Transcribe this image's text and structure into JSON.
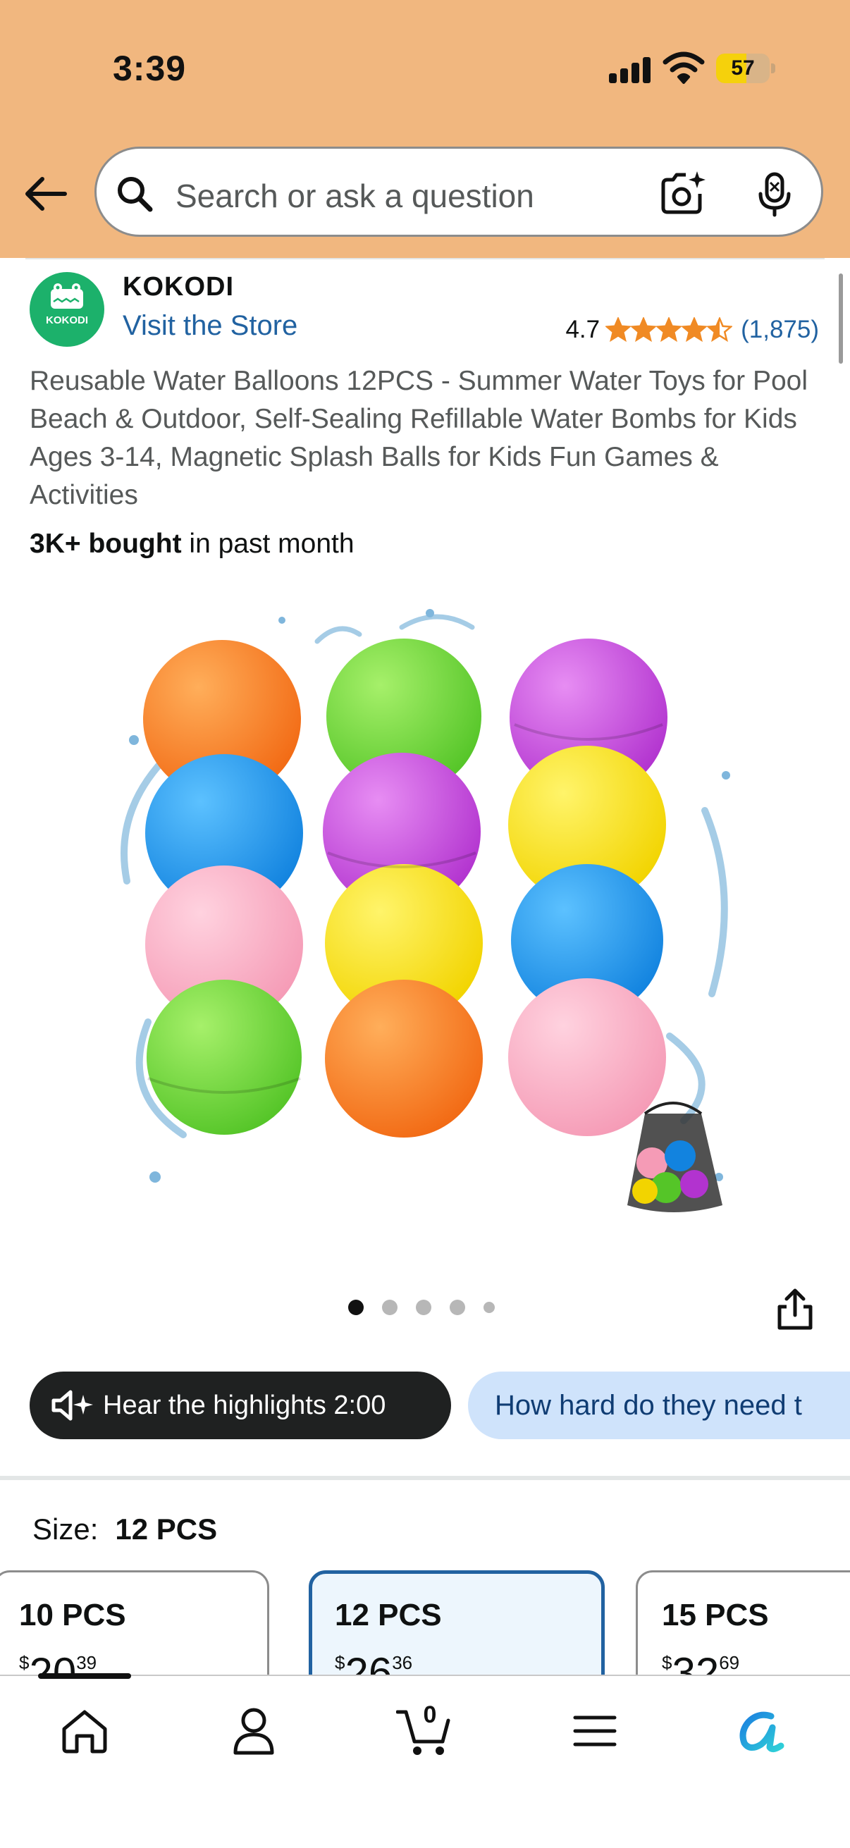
{
  "status_bar": {
    "time": "3:39",
    "battery": "57",
    "battery_level": 0.57
  },
  "search": {
    "placeholder": "Search or ask a question"
  },
  "brand": {
    "name": "KOKODI",
    "logo_text": "KOKODI",
    "visit_store": "Visit the Store"
  },
  "rating": {
    "value": "4.7",
    "stars": 4.5,
    "count": "(1,875)"
  },
  "product": {
    "title": "Reusable Water Balloons 12PCS - Summer Water Toys for Pool Beach & Outdoor, Self-Sealing Refillable Water Bombs for Kids Ages 3-14, Magnetic Splash Balls for Kids Fun Games & Activities",
    "bought_bold": "3K+ bought",
    "bought_rest": " in past month"
  },
  "carousel": {
    "dot_count": 5,
    "active_index": 0
  },
  "chips": {
    "hear_highlights": "Hear the highlights 2:00",
    "question": "How hard do they need t"
  },
  "size": {
    "label": "Size:",
    "selected": "12 PCS",
    "options": [
      {
        "name": "10 PCS",
        "currency": "$",
        "dollars": "20",
        "cents": "39"
      },
      {
        "name": "12 PCS",
        "currency": "$",
        "dollars": "26",
        "cents": "36"
      },
      {
        "name": "15 PCS",
        "currency": "$",
        "dollars": "32",
        "cents": "69"
      }
    ]
  },
  "nav": {
    "cart_count": "0",
    "items": [
      "home-icon",
      "account-icon",
      "cart-icon",
      "menu-icon",
      "rufus-icon"
    ]
  },
  "colors": {
    "header_bg": "#f1b77f",
    "link": "#2162a1",
    "star": "#f08a24",
    "chip_dark": "#1f2121",
    "chip_light": "#cfe3fb",
    "selected_border": "#2162a1"
  }
}
